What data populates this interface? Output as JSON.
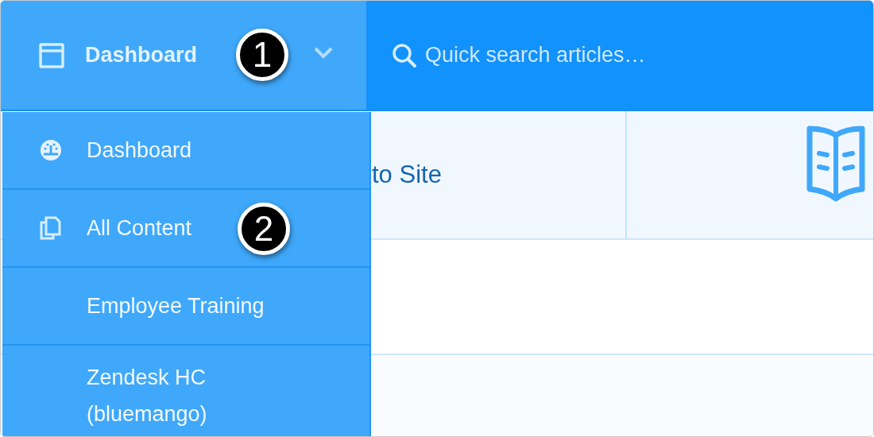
{
  "header": {
    "menu_button": {
      "label": "Dashboard",
      "expanded": true,
      "callout": "1"
    },
    "search": {
      "placeholder": "Quick search articles…"
    }
  },
  "menu": {
    "items": [
      {
        "label": "Dashboard",
        "kind": "gauge"
      },
      {
        "label": "All Content",
        "kind": "pages",
        "callout": "2"
      },
      {
        "label": "Employee Training",
        "kind": "plain"
      },
      {
        "label": "Zendesk HC (bluemango)",
        "kind": "plain"
      }
    ]
  },
  "content": {
    "rows": [
      {
        "cells": [
          {
            "text": "to Site"
          },
          {
            "kind": "book"
          }
        ]
      },
      {
        "cells": []
      },
      {
        "cells": []
      }
    ]
  }
}
